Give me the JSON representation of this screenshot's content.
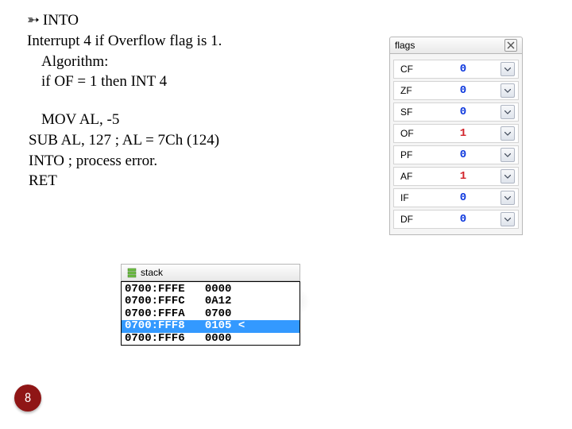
{
  "text": {
    "bullet": "INTO",
    "interrupt": "Interrupt 4 if Overflow flag is 1.",
    "algorithm": "Algorithm:",
    "ifline": "if OF = 1 then INT 4",
    "c1": "MOV AL, -5",
    "c2": "SUB AL, 127 ; AL = 7Ch (124)",
    "c3": "INTO ; process error.",
    "c4": "RET"
  },
  "flags": {
    "title": "flags",
    "rows": [
      {
        "name": "CF",
        "value": "0",
        "hot": false
      },
      {
        "name": "ZF",
        "value": "0",
        "hot": false
      },
      {
        "name": "SF",
        "value": "0",
        "hot": false
      },
      {
        "name": "OF",
        "value": "1",
        "hot": true
      },
      {
        "name": "PF",
        "value": "0",
        "hot": false
      },
      {
        "name": "AF",
        "value": "1",
        "hot": true
      },
      {
        "name": "IF",
        "value": "0",
        "hot": false
      },
      {
        "name": "DF",
        "value": "0",
        "hot": false
      }
    ]
  },
  "stack": {
    "title": "stack",
    "rows": [
      {
        "addr": "0700:FFFE",
        "val": "0000",
        "sel": false,
        "mark": ""
      },
      {
        "addr": "0700:FFFC",
        "val": "0A12",
        "sel": false,
        "mark": ""
      },
      {
        "addr": "0700:FFFA",
        "val": "0700",
        "sel": false,
        "mark": ""
      },
      {
        "addr": "0700:FFF8",
        "val": "0105",
        "sel": true,
        "mark": " <"
      },
      {
        "addr": "0700:FFF6",
        "val": "0000",
        "sel": false,
        "mark": ""
      }
    ]
  },
  "page": "8"
}
